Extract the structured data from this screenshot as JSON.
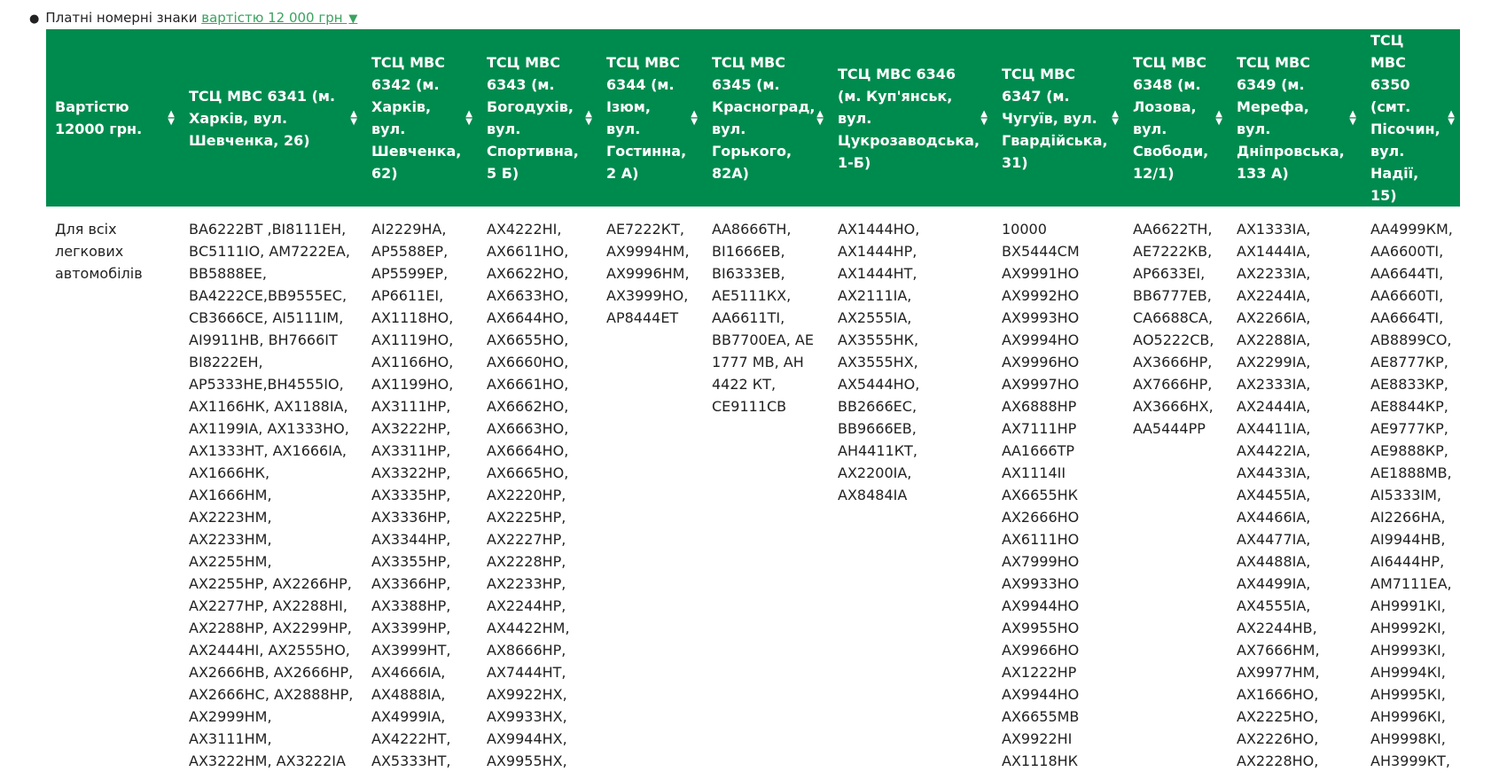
{
  "intro": {
    "text": "Платні номерні знаки",
    "link": "вартістю 12 000 грн",
    "caret": "▼"
  },
  "table": {
    "columns": [
      "Вартістю 12000 грн.",
      "ТСЦ МВС 6341 (м. Харків, вул. Шевченка, 26)",
      "ТСЦ МВС 6342 (м. Харків, вул. Шевченка, 62)",
      "ТСЦ МВС 6343 (м. Богодухів, вул. Спортивна, 5 Б)",
      "ТСЦ МВС 6344 (м. Ізюм, вул. Гостинна, 2 А)",
      "ТСЦ МВС 6345 (м. Красноград, вул. Горького, 82А)",
      "ТСЦ МВС 6346 (м. Куп'янськ, вул. Цукрозаводська, 1-Б)",
      "ТСЦ МВС 6347 (м. Чугуїв, вул. Гвардійська, 31)",
      "ТСЦ МВС 6348 (м. Лозова, вул. Свободи, 12/1)",
      "ТСЦ МВС 6349 (м. Мерефа, вул. Дніпровська, 133 А)",
      "ТСЦ МВС 6350 (смт. Пісочин, вул. Надії, 15)"
    ],
    "row": {
      "label": "Для всіх легкових автомобілів",
      "cells": [
        [
          "ВА6222ВТ ,ВІ8111ЕН,",
          "ВС5111ІО, АМ7222ЕА,",
          "ВВ5888ЕЕ,",
          "ВА4222СЕ,ВВ9555ЕС,",
          "СВ3666СЕ, АІ5111ІМ,",
          "АІ9911НВ, ВН7666ІТ",
          "ВІ8222ЕН,",
          "АР5333НЕ,ВН4555ІО,",
          "АХ1166НК, АХ1188ІА,",
          "АХ1199ІА, АХ1333НО,",
          "АХ1333НТ, АХ1666ІА,",
          "АХ1666НК,",
          "АХ1666НМ,",
          "АХ2223НМ,",
          "АХ2233НМ,",
          "АХ2255НМ,",
          "АХ2255НР, АХ2266НР,",
          "АХ2277НР, АХ2288НІ,",
          "АХ2288НР, АХ2299НР,",
          "АХ2444НІ, АХ2555НО,",
          "АХ2666НВ, АХ2666НР,",
          "АХ2666НС, АХ2888НР,",
          "АХ2999НМ,",
          "АХ3111НМ,",
          "АХ3222НМ, АХ3222ІА"
        ],
        [
          "АІ2229НА,",
          "АР5588ЕР,",
          "АР5599ЕР,",
          "АР6611ЕІ,",
          "АХ1118НО,",
          "АХ1119НО,",
          "АХ1166НО,",
          "АХ1199НО,",
          "АХ3111НР,",
          "АХ3222НР,",
          "АХ3311НР,",
          "АХ3322НР,",
          "АХ3335НР,",
          "АХ3336НР,",
          "АХ3344НР,",
          "АХ3355НР,",
          "АХ3366НР,",
          "АХ3388НР,",
          "АХ3399НР,",
          "АХ3999НТ,",
          "АХ4666ІА,",
          "АХ4888ІА,",
          "АХ4999ІА,",
          "АХ4222НТ,",
          "АХ5333НТ,"
        ],
        [
          "АХ4222НІ,",
          "АХ6611НО,",
          "АХ6622НО,",
          "АХ6633НО,",
          "АХ6644НО,",
          "АХ6655НО,",
          "АХ6660НО,",
          "АХ6661НО,",
          "АХ6662НО,",
          "АХ6663НО,",
          "АХ6664НО,",
          "АХ6665НО,",
          "АХ2220НР,",
          "АХ2225НР,",
          "АХ2227НР,",
          "АХ2228НР,",
          "АХ2233НР,",
          "АХ2244НР,",
          "АХ4422НМ,",
          "АХ8666НР,",
          "АХ7444НТ,",
          "АХ9922НХ,",
          "АХ9933НХ,",
          "АХ9944НХ,",
          "АХ9955НХ,"
        ],
        [
          "АЕ7222КТ,",
          "АХ9994НМ,",
          "АХ9996НМ,",
          "АХ3999НО,",
          "АР8444ЕТ"
        ],
        [
          "АА8666ТН,",
          "ВІ1666ЕВ,",
          "ВІ6333ЕВ,",
          "АЕ5111КХ,",
          "АА6611ТІ,",
          "ВВ7700ЕА, АЕ",
          "1777 МВ, АН",
          "4422 КТ,",
          "СЕ9111СВ"
        ],
        [
          "АХ1444НО,",
          "АХ1444НР,",
          "АХ1444НТ,",
          "АХ2111ІА,",
          "АХ2555ІА,",
          "АХ3555НК,",
          "АХ3555НХ,",
          "АХ5444НО,",
          "ВВ2666ЕС,",
          "ВВ9666ЕВ,",
          "АН4411КТ,",
          "АХ2200ІА,",
          "АХ8484ІА"
        ],
        [
          "10000",
          "ВХ5444СМ",
          "АХ9991НО",
          "АХ9992НО",
          "АХ9993НО",
          "АХ9994НО",
          "АХ9996НО",
          "АХ9997НО",
          "АХ6888НР",
          "АХ7111НР",
          "АА1666ТР",
          "АХ1114ІІ",
          "АХ6655НК",
          "АХ2666НО",
          "АХ6111НО",
          "АХ7999НО",
          "АХ9933НО",
          "АХ9944НО",
          "АХ9955НО",
          "АХ9966НО",
          "АХ1222НР",
          "АХ9944НО",
          "АХ6655МВ",
          "АХ9922НІ",
          "АХ1118НК"
        ],
        [
          "АА6622ТН,",
          "АЕ7222КВ,",
          "АР6633ЕІ,",
          "ВВ6777ЕВ,",
          "СА6688СА,",
          "АО5222СВ,",
          "АХ3666НР,",
          "АХ7666НР,",
          "АХ3666НХ,",
          "АА5444РР"
        ],
        [
          "АХ1333ІА,",
          "АХ1444ІА,",
          "АХ2233ІА,",
          "АХ2244ІА,",
          "АХ2266ІА,",
          "АХ2288ІА,",
          "АХ2299ІА,",
          "АХ2333ІА,",
          "АХ2444ІА,",
          "АХ4411ІА,",
          "АХ4422ІА,",
          "АХ4433ІА,",
          "АХ4455ІА,",
          "АХ4466ІА,",
          "АХ4477ІА,",
          "АХ4488ІА,",
          "АХ4499ІА,",
          "АХ4555ІА,",
          "АХ2244НВ,",
          "АХ7666НМ,",
          "АХ9977НМ,",
          "АХ1666НО,",
          "АХ2225НО,",
          "АХ2226НО,",
          "АХ2228НО,"
        ],
        [
          "АА4999КМ,",
          "АА6600ТІ,",
          "АА6644ТІ,",
          "АА6660ТІ,",
          "АА6664ТІ,",
          "АВ8899СО,",
          "АЕ8777КР,",
          "АЕ8833КР,",
          "АЕ8844КР,",
          "АЕ9777КР,",
          "АЕ9888КР,",
          "АЕ1888МВ,",
          "АІ5333ІМ,",
          "АІ2266НА,",
          "АІ9944НВ,",
          "АІ6444НР,",
          "АМ7111ЕА,",
          "АН9991КІ,",
          "АН9992КІ,",
          "АН9993КІ,",
          "АН9994КІ,",
          "АН9995КІ,",
          "АН9996КІ,",
          "АН9998КІ,",
          "АН3999КТ,"
        ]
      ]
    }
  }
}
